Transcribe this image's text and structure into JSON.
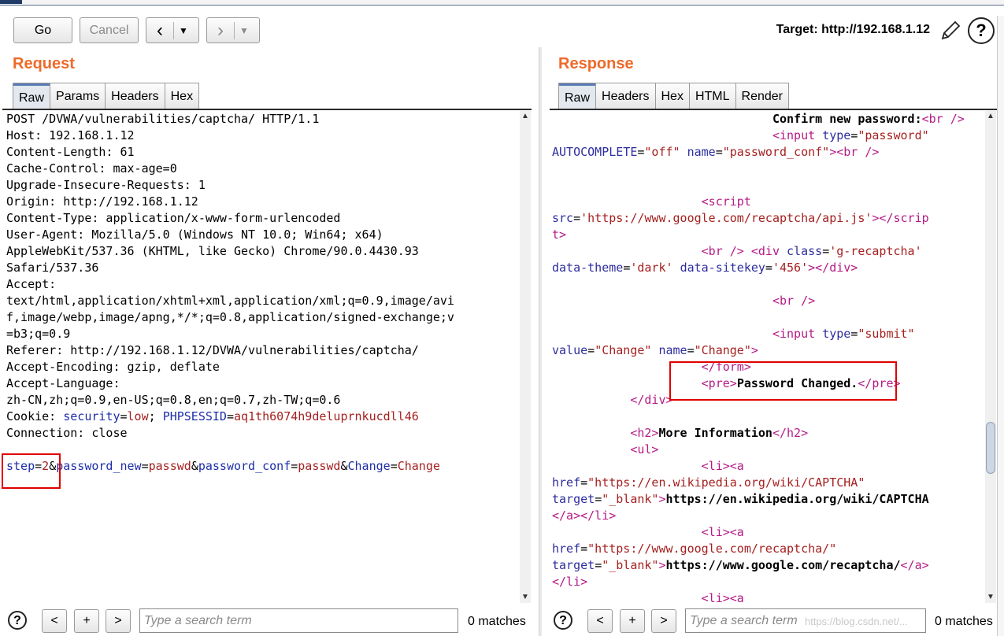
{
  "toolbar": {
    "go_label": "Go",
    "cancel_label": "Cancel",
    "back_icon": "‹",
    "forward_icon": "›",
    "dropdown_icon": "▼",
    "target_label": "Target: http://192.168.1.12"
  },
  "request": {
    "title": "Request",
    "tabs": [
      "Raw",
      "Params",
      "Headers",
      "Hex"
    ],
    "active_tab": "Raw",
    "search_placeholder": "Type a search term",
    "matches": "0 matches",
    "lines": [
      "POST /DVWA/vulnerabilities/captcha/ HTTP/1.1",
      "Host: 192.168.1.12",
      "Content-Length: 61",
      "Cache-Control: max-age=0",
      "Upgrade-Insecure-Requests: 1",
      "Origin: http://192.168.1.12",
      "Content-Type: application/x-www-form-urlencoded",
      "User-Agent: Mozilla/5.0 (Windows NT 10.0; Win64; x64)",
      "AppleWebKit/537.36 (KHTML, like Gecko) Chrome/90.0.4430.93",
      "Safari/537.36",
      "Accept:",
      "text/html,application/xhtml+xml,application/xml;q=0.9,image/avi",
      "f,image/webp,image/apng,*/*;q=0.8,application/signed-exchange;v",
      "=b3;q=0.9",
      "Referer: http://192.168.1.12/DVWA/vulnerabilities/captcha/",
      "Accept-Encoding: gzip, deflate",
      "Accept-Language:",
      "zh-CN,zh;q=0.9,en-US;q=0.8,en;q=0.7,zh-TW;q=0.6"
    ],
    "cookie": {
      "label": "Cookie: ",
      "k1": "security",
      "v1": "low",
      "k2": "PHPSESSID",
      "v2": "aq1th6074h9deluprnkucdll46"
    },
    "connection": "Connection: close",
    "body": {
      "k1": "step",
      "v1": "2",
      "k2": "password_new",
      "v2": "passwd",
      "k3": "password_conf",
      "v3": "passwd",
      "k4": "Change",
      "v4": "Change"
    }
  },
  "response": {
    "title": "Response",
    "tabs": [
      "Raw",
      "Headers",
      "Hex",
      "HTML",
      "Render"
    ],
    "active_tab": "Raw",
    "search_placeholder": "Type a search term",
    "matches": "0 matches",
    "code": {
      "confirm_text": "Confirm new password:",
      "br_tag": "<br />",
      "input_open": "<input",
      "type_attr": "type",
      "password_val": "\"password\"",
      "autocomplete_attr": "AUTOCOMPLETE",
      "off_val": "\"off\"",
      "name_attr": "name",
      "password_conf_val": "\"password_conf\"",
      "script_open": "<script",
      "src_attr": "src",
      "src_val": "'https://www.google.com/recaptcha/api.js'",
      "script_close_a": "></scrip",
      "script_close_b": "t>",
      "div_open": "<div",
      "class_attr": "class",
      "class_val": "'g-recaptcha'",
      "theme_attr": "data-theme",
      "theme_val": "'dark'",
      "sitekey_attr": "data-sitekey",
      "sitekey_val": "'456'",
      "div_close_inline": "></div>",
      "submit_val": "\"submit\"",
      "value_attr": "value",
      "change_val": "\"Change\"",
      "gt": ">",
      "form_close": "</form>",
      "pre_open": "<pre>",
      "pre_text": "Password Changed.",
      "pre_close": "</pre>",
      "div_close": "</div>",
      "h2_open": "<h2>",
      "h2_text": "More Information",
      "h2_close": "</h2>",
      "ul_open": "<ul>",
      "li_a_open": "<li><a",
      "href_attr": "href",
      "href1_val": "\"https://en.wikipedia.org/wiki/CAPTCHA\"",
      "target_attr": "target",
      "blank_val": "\"_blank\"",
      "link1_text": "https://en.wikipedia.org/wiki/CAPTCHA",
      "a_li_close": "</a></li>",
      "href2_val": "\"https://www.google.com/recaptcha/\"",
      "link2_text": "https://www.google.com/recaptcha/",
      "a_close": "</a>",
      "li_close": "</li>"
    }
  },
  "watermark": "https://blog.csdn.net/..."
}
